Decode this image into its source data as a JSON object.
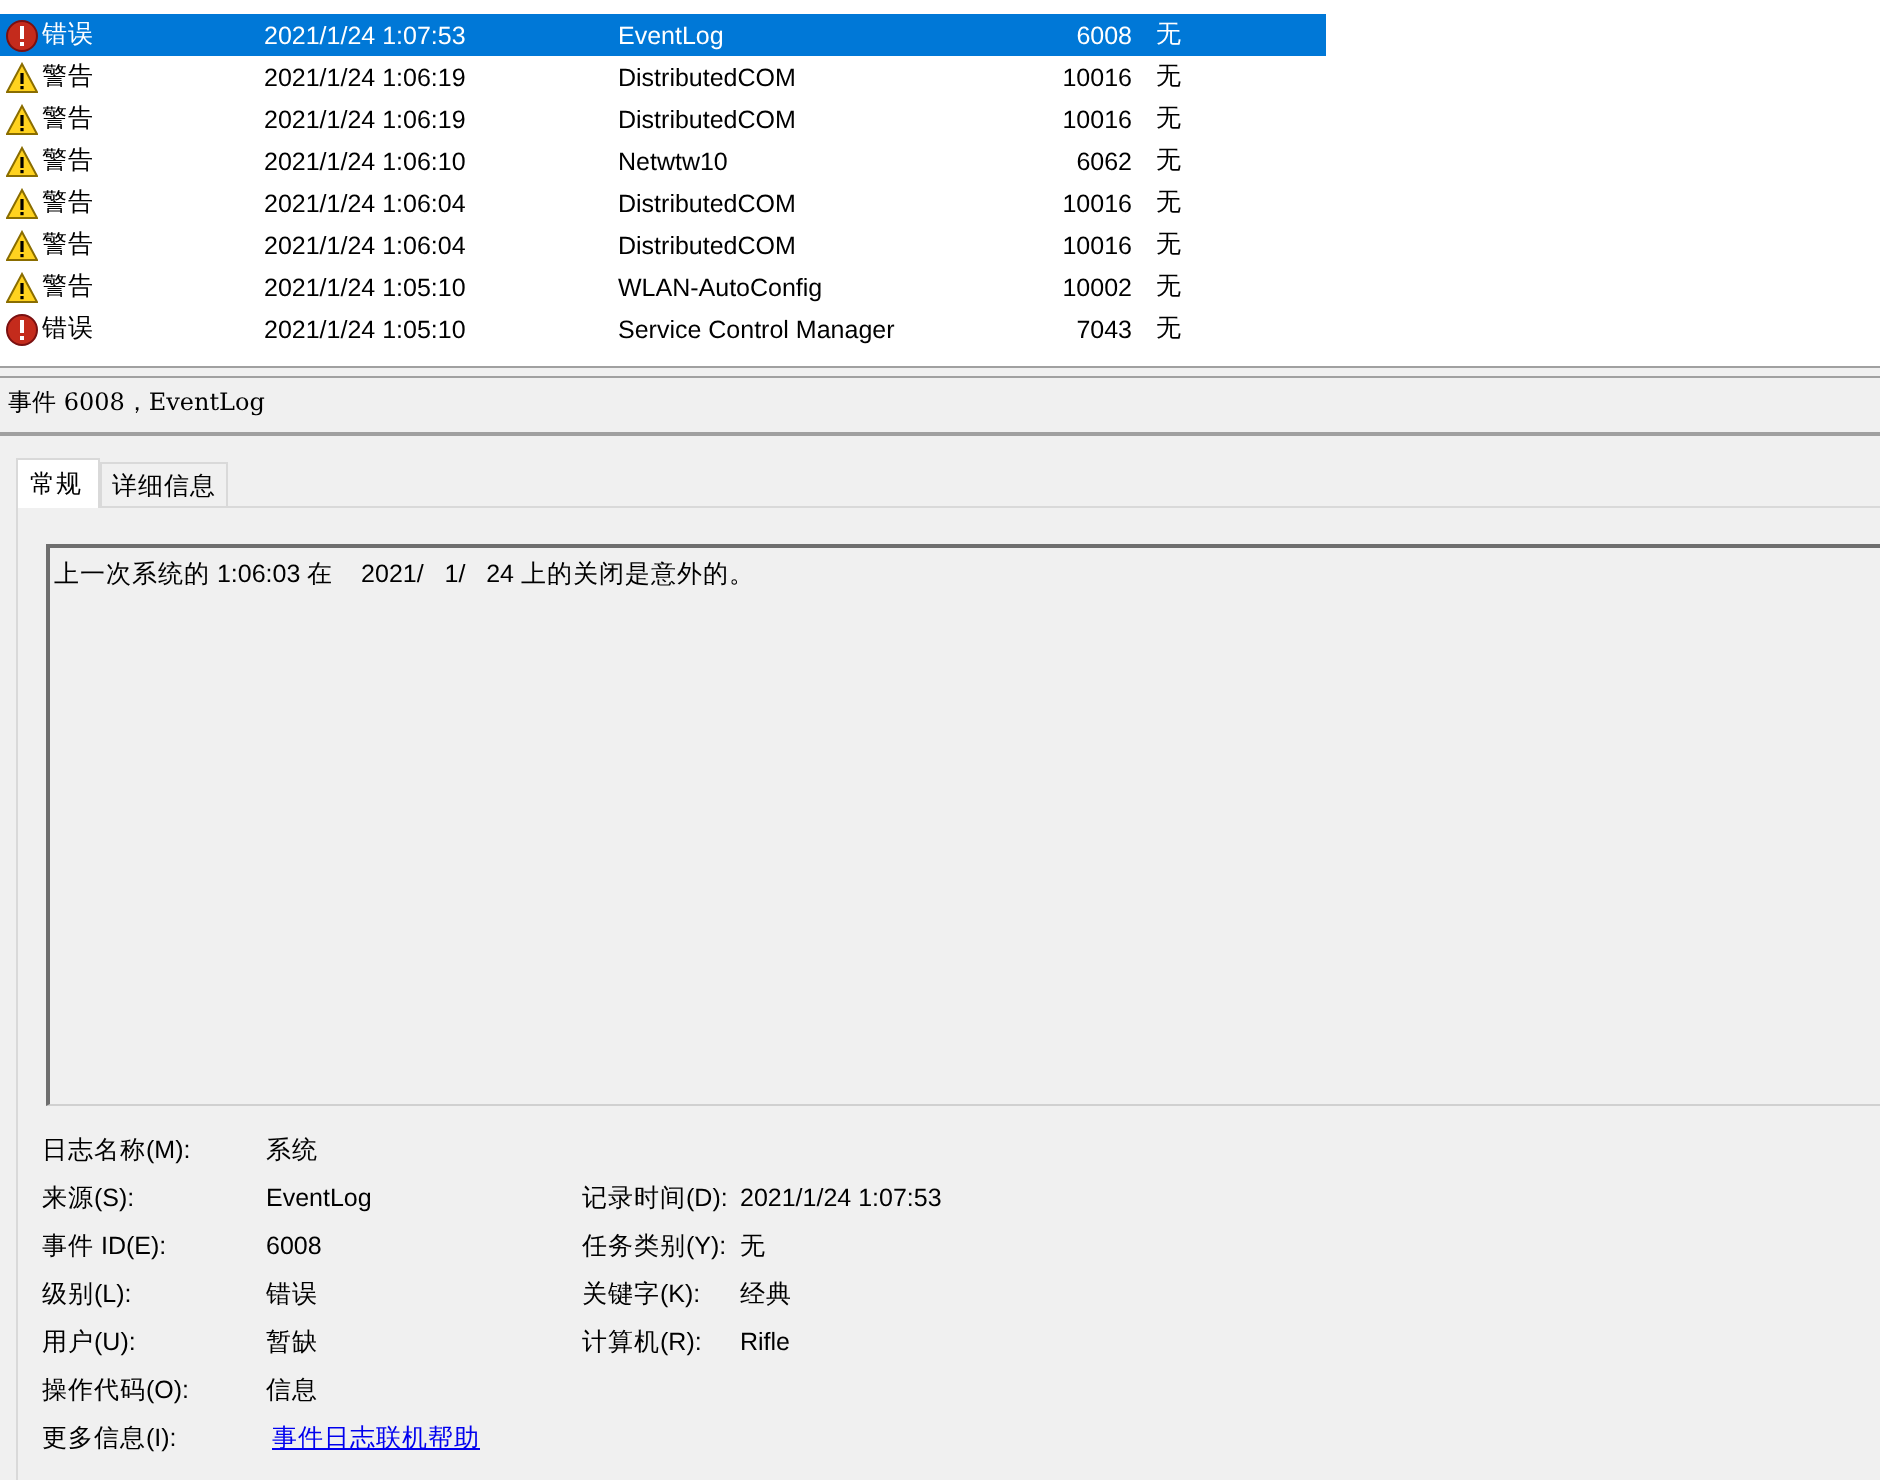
{
  "events": {
    "rows": [
      {
        "kind": "error",
        "level": "错误",
        "date": "2021/1/24 1:07:53",
        "source": "EventLog",
        "event_id": "6008",
        "task": "无",
        "selected": true
      },
      {
        "kind": "warning",
        "level": "警告",
        "date": "2021/1/24 1:06:19",
        "source": "DistributedCOM",
        "event_id": "10016",
        "task": "无",
        "selected": false
      },
      {
        "kind": "warning",
        "level": "警告",
        "date": "2021/1/24 1:06:19",
        "source": "DistributedCOM",
        "event_id": "10016",
        "task": "无",
        "selected": false
      },
      {
        "kind": "warning",
        "level": "警告",
        "date": "2021/1/24 1:06:10",
        "source": "Netwtw10",
        "event_id": "6062",
        "task": "无",
        "selected": false
      },
      {
        "kind": "warning",
        "level": "警告",
        "date": "2021/1/24 1:06:04",
        "source": "DistributedCOM",
        "event_id": "10016",
        "task": "无",
        "selected": false
      },
      {
        "kind": "warning",
        "level": "警告",
        "date": "2021/1/24 1:06:04",
        "source": "DistributedCOM",
        "event_id": "10016",
        "task": "无",
        "selected": false
      },
      {
        "kind": "warning",
        "level": "警告",
        "date": "2021/1/24 1:05:10",
        "source": "WLAN-AutoConfig",
        "event_id": "10002",
        "task": "无",
        "selected": false
      },
      {
        "kind": "error",
        "level": "错误",
        "date": "2021/1/24 1:05:10",
        "source": "Service Control Manager",
        "event_id": "7043",
        "task": "无",
        "selected": false
      }
    ]
  },
  "detail": {
    "title": "事件 6008，EventLog",
    "tabs": [
      {
        "label": "常规",
        "selected": true
      },
      {
        "label": "详细信息",
        "selected": false
      }
    ],
    "message": "上一次系统的 1:06:03 在    2021/   1/   24 上的关闭是意外的。",
    "fields": [
      {
        "label": "日志名称(M):",
        "value": "系统"
      },
      {
        "label": "来源(S):",
        "value": "EventLog",
        "label2": "记录时间(D):",
        "value2": "2021/1/24 1:07:53"
      },
      {
        "label": "事件 ID(E):",
        "value": "6008",
        "label2": "任务类别(Y):",
        "value2": "无"
      },
      {
        "label": "级别(L):",
        "value": "错误",
        "label2": "关键字(K):",
        "value2": "经典"
      },
      {
        "label": "用户(U):",
        "value": "暂缺",
        "label2": "计算机(R):",
        "value2": "Rifle"
      },
      {
        "label": "操作代码(O):",
        "value": "信息"
      },
      {
        "label": "更多信息(I):",
        "value": "事件日志联机帮助",
        "kind": "link"
      }
    ]
  }
}
